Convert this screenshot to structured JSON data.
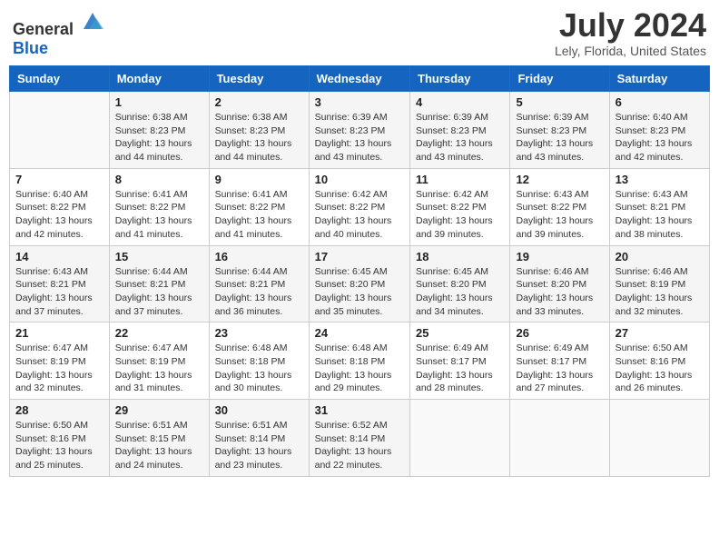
{
  "header": {
    "logo_general": "General",
    "logo_blue": "Blue",
    "month_year": "July 2024",
    "location": "Lely, Florida, United States"
  },
  "days_of_week": [
    "Sunday",
    "Monday",
    "Tuesday",
    "Wednesday",
    "Thursday",
    "Friday",
    "Saturday"
  ],
  "weeks": [
    [
      {
        "day": "",
        "sunrise": "",
        "sunset": "",
        "daylight": ""
      },
      {
        "day": "1",
        "sunrise": "Sunrise: 6:38 AM",
        "sunset": "Sunset: 8:23 PM",
        "daylight": "Daylight: 13 hours and 44 minutes."
      },
      {
        "day": "2",
        "sunrise": "Sunrise: 6:38 AM",
        "sunset": "Sunset: 8:23 PM",
        "daylight": "Daylight: 13 hours and 44 minutes."
      },
      {
        "day": "3",
        "sunrise": "Sunrise: 6:39 AM",
        "sunset": "Sunset: 8:23 PM",
        "daylight": "Daylight: 13 hours and 43 minutes."
      },
      {
        "day": "4",
        "sunrise": "Sunrise: 6:39 AM",
        "sunset": "Sunset: 8:23 PM",
        "daylight": "Daylight: 13 hours and 43 minutes."
      },
      {
        "day": "5",
        "sunrise": "Sunrise: 6:39 AM",
        "sunset": "Sunset: 8:23 PM",
        "daylight": "Daylight: 13 hours and 43 minutes."
      },
      {
        "day": "6",
        "sunrise": "Sunrise: 6:40 AM",
        "sunset": "Sunset: 8:23 PM",
        "daylight": "Daylight: 13 hours and 42 minutes."
      }
    ],
    [
      {
        "day": "7",
        "sunrise": "Sunrise: 6:40 AM",
        "sunset": "Sunset: 8:22 PM",
        "daylight": "Daylight: 13 hours and 42 minutes."
      },
      {
        "day": "8",
        "sunrise": "Sunrise: 6:41 AM",
        "sunset": "Sunset: 8:22 PM",
        "daylight": "Daylight: 13 hours and 41 minutes."
      },
      {
        "day": "9",
        "sunrise": "Sunrise: 6:41 AM",
        "sunset": "Sunset: 8:22 PM",
        "daylight": "Daylight: 13 hours and 41 minutes."
      },
      {
        "day": "10",
        "sunrise": "Sunrise: 6:42 AM",
        "sunset": "Sunset: 8:22 PM",
        "daylight": "Daylight: 13 hours and 40 minutes."
      },
      {
        "day": "11",
        "sunrise": "Sunrise: 6:42 AM",
        "sunset": "Sunset: 8:22 PM",
        "daylight": "Daylight: 13 hours and 39 minutes."
      },
      {
        "day": "12",
        "sunrise": "Sunrise: 6:43 AM",
        "sunset": "Sunset: 8:22 PM",
        "daylight": "Daylight: 13 hours and 39 minutes."
      },
      {
        "day": "13",
        "sunrise": "Sunrise: 6:43 AM",
        "sunset": "Sunset: 8:21 PM",
        "daylight": "Daylight: 13 hours and 38 minutes."
      }
    ],
    [
      {
        "day": "14",
        "sunrise": "Sunrise: 6:43 AM",
        "sunset": "Sunset: 8:21 PM",
        "daylight": "Daylight: 13 hours and 37 minutes."
      },
      {
        "day": "15",
        "sunrise": "Sunrise: 6:44 AM",
        "sunset": "Sunset: 8:21 PM",
        "daylight": "Daylight: 13 hours and 37 minutes."
      },
      {
        "day": "16",
        "sunrise": "Sunrise: 6:44 AM",
        "sunset": "Sunset: 8:21 PM",
        "daylight": "Daylight: 13 hours and 36 minutes."
      },
      {
        "day": "17",
        "sunrise": "Sunrise: 6:45 AM",
        "sunset": "Sunset: 8:20 PM",
        "daylight": "Daylight: 13 hours and 35 minutes."
      },
      {
        "day": "18",
        "sunrise": "Sunrise: 6:45 AM",
        "sunset": "Sunset: 8:20 PM",
        "daylight": "Daylight: 13 hours and 34 minutes."
      },
      {
        "day": "19",
        "sunrise": "Sunrise: 6:46 AM",
        "sunset": "Sunset: 8:20 PM",
        "daylight": "Daylight: 13 hours and 33 minutes."
      },
      {
        "day": "20",
        "sunrise": "Sunrise: 6:46 AM",
        "sunset": "Sunset: 8:19 PM",
        "daylight": "Daylight: 13 hours and 32 minutes."
      }
    ],
    [
      {
        "day": "21",
        "sunrise": "Sunrise: 6:47 AM",
        "sunset": "Sunset: 8:19 PM",
        "daylight": "Daylight: 13 hours and 32 minutes."
      },
      {
        "day": "22",
        "sunrise": "Sunrise: 6:47 AM",
        "sunset": "Sunset: 8:19 PM",
        "daylight": "Daylight: 13 hours and 31 minutes."
      },
      {
        "day": "23",
        "sunrise": "Sunrise: 6:48 AM",
        "sunset": "Sunset: 8:18 PM",
        "daylight": "Daylight: 13 hours and 30 minutes."
      },
      {
        "day": "24",
        "sunrise": "Sunrise: 6:48 AM",
        "sunset": "Sunset: 8:18 PM",
        "daylight": "Daylight: 13 hours and 29 minutes."
      },
      {
        "day": "25",
        "sunrise": "Sunrise: 6:49 AM",
        "sunset": "Sunset: 8:17 PM",
        "daylight": "Daylight: 13 hours and 28 minutes."
      },
      {
        "day": "26",
        "sunrise": "Sunrise: 6:49 AM",
        "sunset": "Sunset: 8:17 PM",
        "daylight": "Daylight: 13 hours and 27 minutes."
      },
      {
        "day": "27",
        "sunrise": "Sunrise: 6:50 AM",
        "sunset": "Sunset: 8:16 PM",
        "daylight": "Daylight: 13 hours and 26 minutes."
      }
    ],
    [
      {
        "day": "28",
        "sunrise": "Sunrise: 6:50 AM",
        "sunset": "Sunset: 8:16 PM",
        "daylight": "Daylight: 13 hours and 25 minutes."
      },
      {
        "day": "29",
        "sunrise": "Sunrise: 6:51 AM",
        "sunset": "Sunset: 8:15 PM",
        "daylight": "Daylight: 13 hours and 24 minutes."
      },
      {
        "day": "30",
        "sunrise": "Sunrise: 6:51 AM",
        "sunset": "Sunset: 8:14 PM",
        "daylight": "Daylight: 13 hours and 23 minutes."
      },
      {
        "day": "31",
        "sunrise": "Sunrise: 6:52 AM",
        "sunset": "Sunset: 8:14 PM",
        "daylight": "Daylight: 13 hours and 22 minutes."
      },
      {
        "day": "",
        "sunrise": "",
        "sunset": "",
        "daylight": ""
      },
      {
        "day": "",
        "sunrise": "",
        "sunset": "",
        "daylight": ""
      },
      {
        "day": "",
        "sunrise": "",
        "sunset": "",
        "daylight": ""
      }
    ]
  ]
}
